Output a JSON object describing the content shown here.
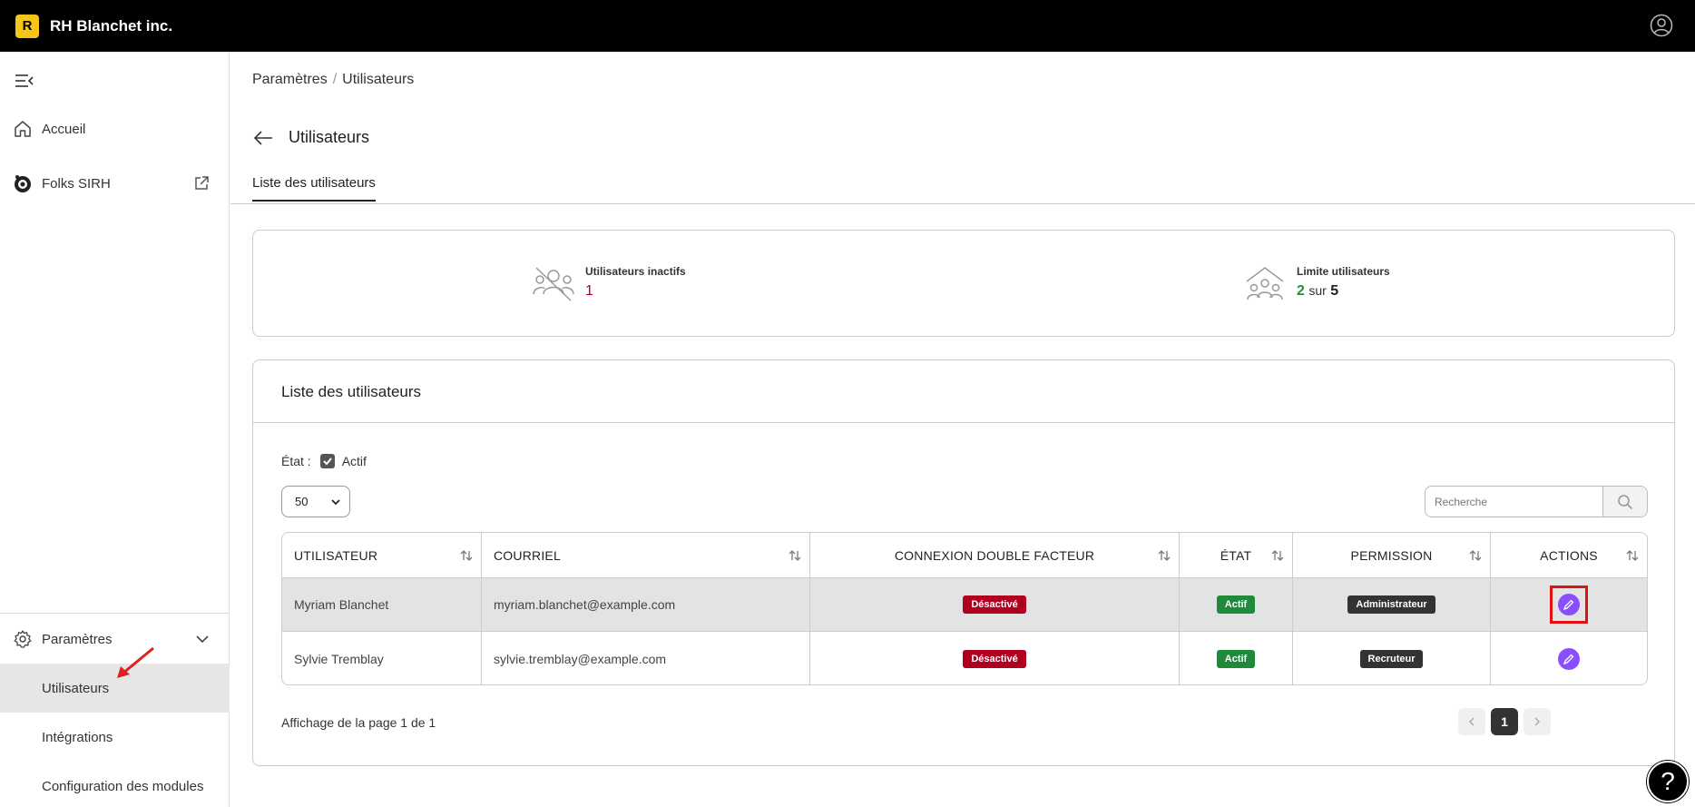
{
  "header": {
    "logo_letter": "R",
    "brand": "RH Blanchet inc."
  },
  "sidebar": {
    "items": [
      {
        "label": "Accueil",
        "icon": "home-icon"
      },
      {
        "label": "Folks SIRH",
        "icon": "folks-logo-icon"
      }
    ],
    "settings": {
      "label": "Paramètres",
      "subitems": [
        {
          "label": "Utilisateurs",
          "active": true
        },
        {
          "label": "Intégrations"
        },
        {
          "label": "Configuration des modules"
        }
      ]
    }
  },
  "breadcrumb": {
    "parent": "Paramètres",
    "separator": "/",
    "current": "Utilisateurs"
  },
  "page": {
    "title": "Utilisateurs",
    "tab": "Liste des utilisateurs"
  },
  "stats": {
    "inactive": {
      "label": "Utilisateurs inactifs",
      "value": "1"
    },
    "limit": {
      "label": "Limite utilisateurs",
      "used": "2",
      "sur": "sur",
      "max": "5"
    }
  },
  "list": {
    "title": "Liste des utilisateurs",
    "filter_label": "État :",
    "filter_option": "Actif",
    "page_size": "50",
    "search_placeholder": "Recherche",
    "columns": [
      "UTILISATEUR",
      "COURRIEL",
      "CONNEXION DOUBLE FACTEUR",
      "ÉTAT",
      "PERMISSION",
      "ACTIONS"
    ],
    "rows": [
      {
        "user": "Myriam Blanchet",
        "email": "myriam.blanchet@example.com",
        "twofa": "Désactivé",
        "state": "Actif",
        "permission": "Administrateur"
      },
      {
        "user": "Sylvie Tremblay",
        "email": "sylvie.tremblay@example.com",
        "twofa": "Désactivé",
        "state": "Actif",
        "permission": "Recruteur"
      }
    ],
    "pagination_text": "Affichage de la page 1 de 1",
    "current_page": "1"
  },
  "help_label": "?",
  "colors": {
    "accent": "#8a4dff",
    "danger": "#b00020",
    "success": "#1f8a3a",
    "logo": "#f5c518"
  }
}
